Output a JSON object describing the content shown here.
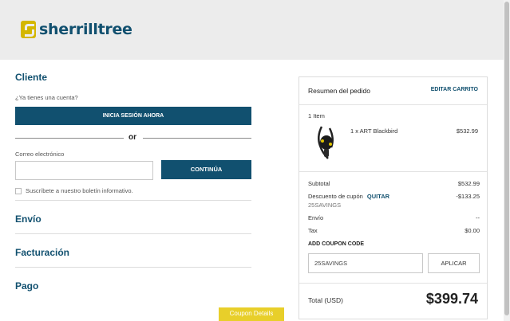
{
  "brand": {
    "name": "sherrilltree"
  },
  "customer": {
    "title": "Cliente",
    "have_account": "¿Ya tienes una cuenta?",
    "login_button": "INICIA SESIÓN AHORA",
    "or": "or",
    "email_label": "Correo electrónico",
    "email_value": "",
    "continue_button": "CONTINÚA",
    "newsletter_label": "Suscríbete a nuestro boletín informativo.",
    "newsletter_checked": false
  },
  "sections": {
    "shipping": "Envío",
    "billing": "Facturación",
    "payment": "Pago"
  },
  "summary": {
    "title": "Resumen del pedido",
    "edit_cart": "EDITAR CARRITO",
    "item_count": "1 Item",
    "item_name": "1 x ART Blackbird",
    "item_price": "$532.99",
    "subtotal_label": "Subtotal",
    "subtotal_value": "$532.99",
    "discount_label": "Descuento de cupón",
    "discount_remove": "QUITAR",
    "discount_code": "25SAVINGS",
    "discount_value": "-$133.25",
    "shipping_label": "Envío",
    "shipping_value": "--",
    "tax_label": "Tax",
    "tax_value": "$0.00",
    "coupon_heading": "ADD COUPON CODE",
    "coupon_value": "25SAVINGS",
    "apply_button": "APLICAR",
    "total_label": "Total (USD)",
    "total_value": "$399.74"
  },
  "coupon_details": "Coupon Details",
  "colors": {
    "brand": "#11506f",
    "accent": "#d4b700",
    "coupon_button": "#e8cf2a"
  }
}
